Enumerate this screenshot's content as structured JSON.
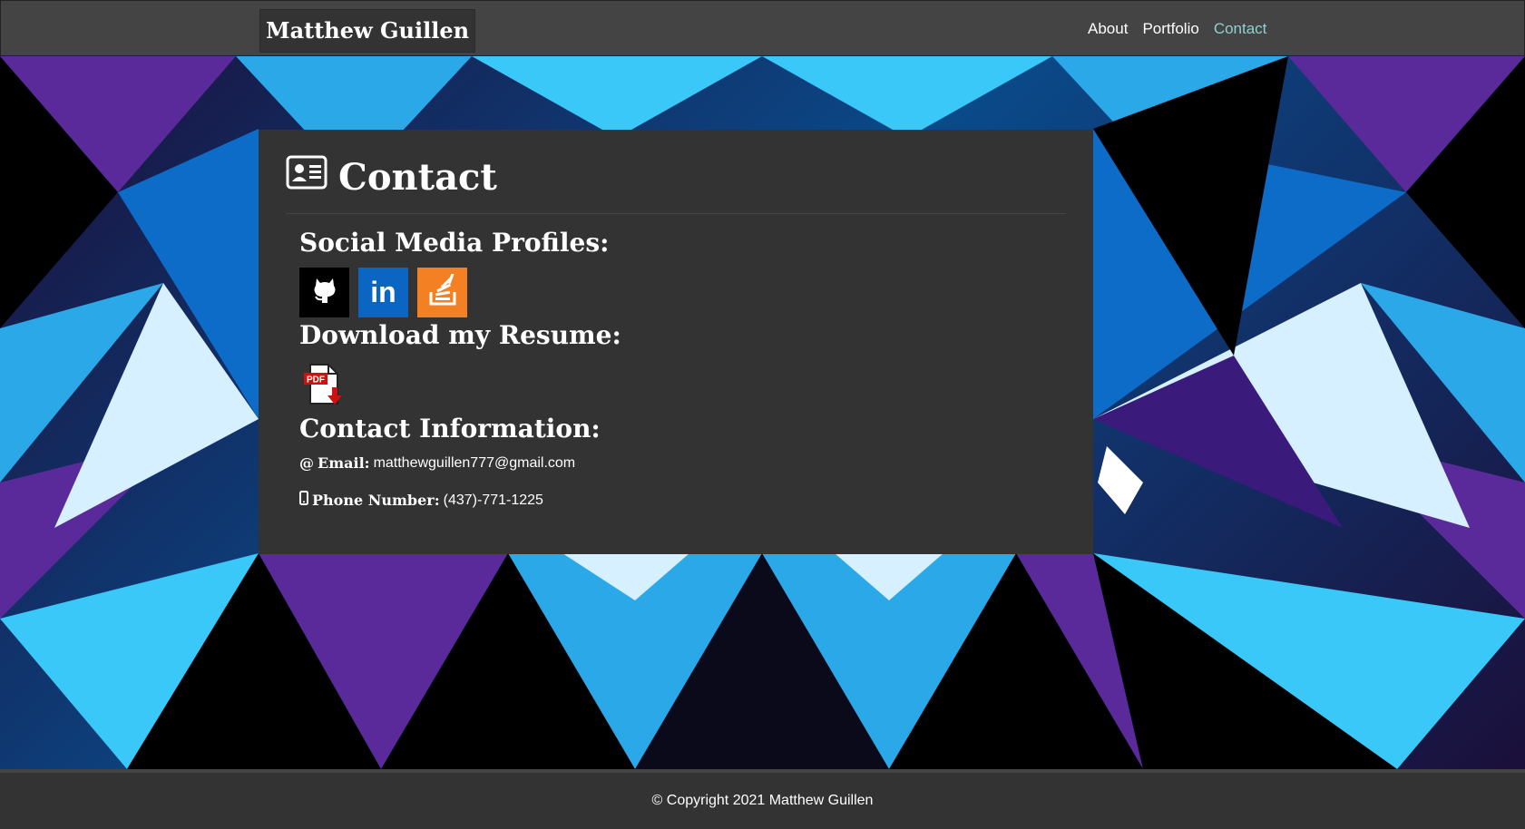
{
  "nav": {
    "brand": "Matthew Guillen",
    "links": [
      {
        "label": "About",
        "active": false
      },
      {
        "label": "Portfolio",
        "active": false
      },
      {
        "label": "Contact",
        "active": true
      }
    ]
  },
  "contact": {
    "title": "Contact",
    "social_heading": "Social Media Profiles:",
    "social_links": [
      {
        "name": "GitHub",
        "icon": "github-icon"
      },
      {
        "name": "LinkedIn",
        "icon": "linkedin-icon",
        "text": "in"
      },
      {
        "name": "Stack Overflow",
        "icon": "stackoverflow-icon"
      }
    ],
    "resume_heading": "Download my Resume:",
    "resume_icon": {
      "icon": "pdf-download-icon",
      "text": "PDF"
    },
    "info_heading": "Contact Information:",
    "email_symbol": "@",
    "email_label": "Email:",
    "email_value": "matthewguillen777@gmail.com",
    "phone_label": "Phone Number:",
    "phone_value": "(437)-771-1225"
  },
  "footer": {
    "copyright": "© Copyright 2021 Matthew Guillen"
  },
  "colors": {
    "navbar": "#444444",
    "panel": "#333333",
    "active_link": "#8fd0d0",
    "github": "#000000",
    "linkedin": "#0a66c2",
    "stackoverflow": "#f48024"
  }
}
